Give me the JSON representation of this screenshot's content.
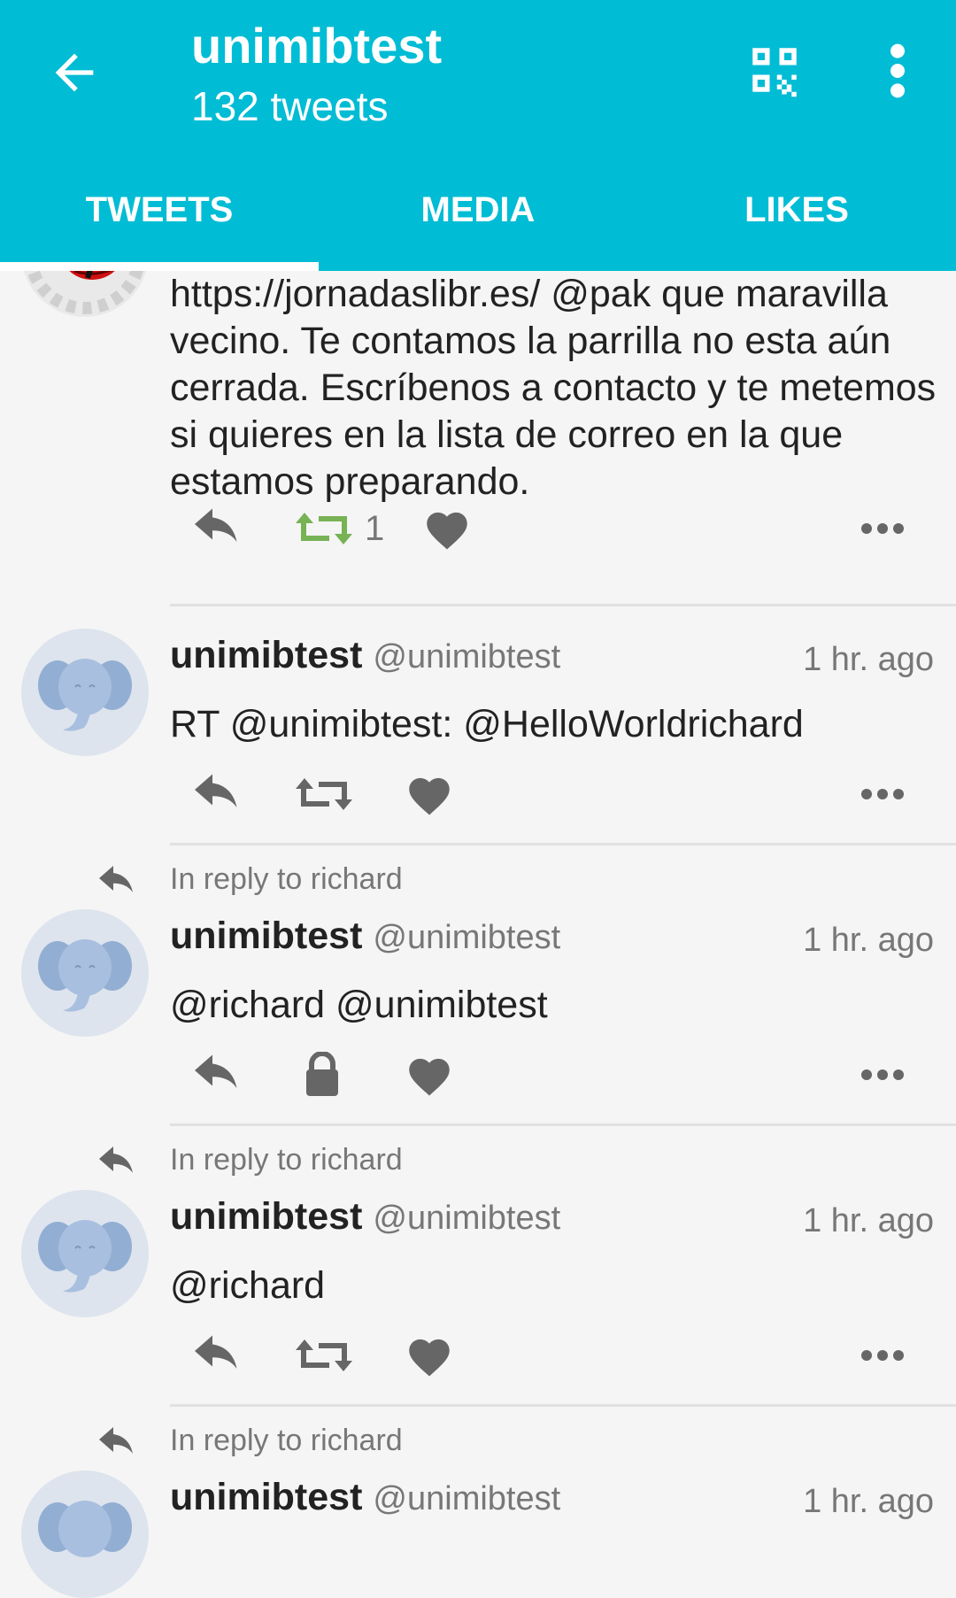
{
  "header": {
    "title": "unimibtest",
    "subtitle": "132 tweets",
    "back_icon": "arrow-back-icon",
    "qr_icon": "qr-code-icon",
    "menu_icon": "more-vert-icon"
  },
  "tabs": [
    {
      "label": "TWEETS",
      "active": true
    },
    {
      "label": "MEDIA",
      "active": false
    },
    {
      "label": "LIKES",
      "active": false
    }
  ],
  "tweets": [
    {
      "text": "https://jornadaslibr.es/ @pak que maravilla vecino. Te contamos la parrilla no esta aún cerrada. Escríbenos a contacto y te metemos si quieres en la lista de correo en la que estamos preparando.",
      "retweet_count": "1"
    },
    {
      "name": "unimibtest",
      "handle": "@unimibtest",
      "time": "1 hr. ago",
      "text": "RT @unimibtest: @HelloWorldrichard"
    },
    {
      "reply_to": "In reply to richard",
      "name": "unimibtest",
      "handle": "@unimibtest",
      "time": "1 hr. ago",
      "text": "@richard @unimibtest"
    },
    {
      "reply_to": "In reply to richard",
      "name": "unimibtest",
      "handle": "@unimibtest",
      "time": "1 hr. ago",
      "text": "@richard"
    },
    {
      "reply_to": "In reply to richard",
      "name": "unimibtest",
      "handle": "@unimibtest",
      "time": "1 hr. ago"
    }
  ],
  "colors": {
    "app_bar": "#00bcd4",
    "retweet_active": "#77b255",
    "icon_gray": "#666666"
  }
}
